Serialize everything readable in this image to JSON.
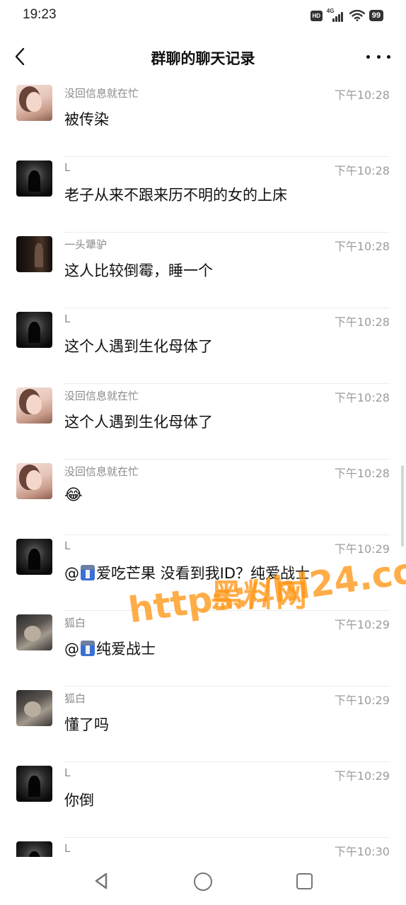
{
  "status_bar": {
    "time": "19:23",
    "hd_badge": "HD",
    "network": "4G",
    "battery": "99"
  },
  "header": {
    "title": "群聊的聊天记录"
  },
  "messages": [
    {
      "sender": "没回信息就在忙",
      "time": "下午10:28",
      "text": "被传染",
      "avatar": "girl-avatar"
    },
    {
      "sender": "L",
      "time": "下午10:28",
      "text": "老子从来不跟来历不明的女的上床",
      "avatar": "dark-figure-avatar"
    },
    {
      "sender": "一头犟驴",
      "time": "下午10:28",
      "text": "这人比较倒霉，睡一个",
      "avatar": "doorway-avatar"
    },
    {
      "sender": "L",
      "time": "下午10:28",
      "text": "这个人遇到生化母体了",
      "avatar": "dark-figure-avatar"
    },
    {
      "sender": "没回信息就在忙",
      "time": "下午10:28",
      "text": "这个人遇到生化母体了",
      "avatar": "girl-avatar"
    },
    {
      "sender": "没回信息就在忙",
      "time": "下午10:28",
      "text": "😂",
      "avatar": "girl-avatar"
    },
    {
      "sender": "L",
      "time": "下午10:29",
      "text_before": "@",
      "text_after": "爱吃芒果 没看到我ID？纯爱战士",
      "avatar": "dark-figure-avatar"
    },
    {
      "sender": "狐白",
      "time": "下午10:29",
      "text_before": "@",
      "text_after": "纯爱战士",
      "avatar": "cat-avatar"
    },
    {
      "sender": "狐白",
      "time": "下午10:29",
      "text": "懂了吗",
      "avatar": "cat-avatar"
    },
    {
      "sender": "L",
      "time": "下午10:29",
      "text": "你倒",
      "avatar": "dark-figure-avatar"
    },
    {
      "sender": "L",
      "time": "下午10:30",
      "text": "",
      "avatar": "dark-figure-avatar"
    }
  ],
  "watermark": {
    "line1": "黑料网",
    "line2": "https://hl24.co"
  },
  "icons": {
    "back": "chevron-left-icon",
    "more": "more-dots-icon",
    "mention": "person-suit-icon",
    "nav_back": "triangle-back-icon",
    "nav_home": "circle-home-icon",
    "nav_recent": "square-recent-icon"
  }
}
